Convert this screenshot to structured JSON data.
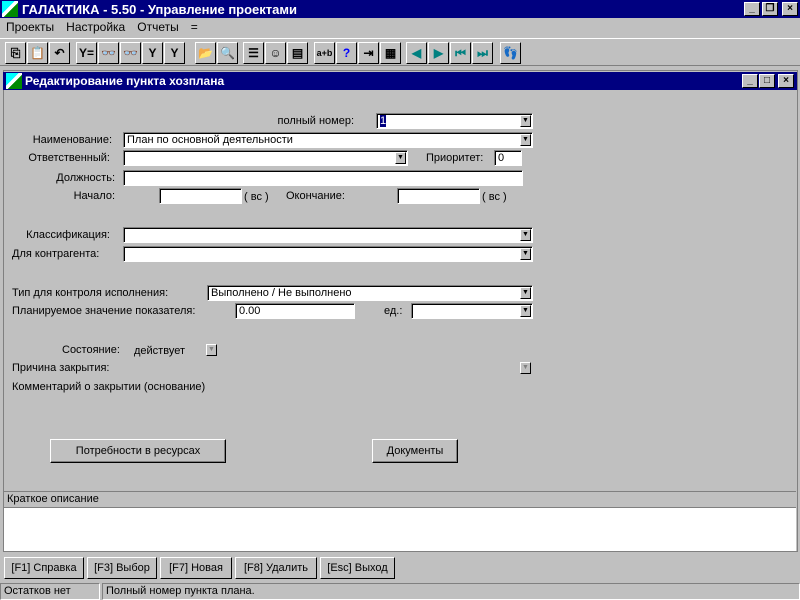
{
  "app": {
    "title": "ГАЛАКТИКА - 5.50 - Управление проектами",
    "controls": [
      "_",
      "❐",
      "×"
    ]
  },
  "menu": [
    "Проекты",
    "Настройка",
    "Отчеты",
    "="
  ],
  "toolbar": [
    {
      "name": "copy",
      "glyph": "⎘"
    },
    {
      "name": "paste",
      "glyph": "📋"
    },
    {
      "name": "undo",
      "glyph": "↶"
    },
    {
      "name": "filter",
      "glyph": "Y="
    },
    {
      "name": "find",
      "glyph": "👓"
    },
    {
      "name": "find-more",
      "glyph": "👓"
    },
    {
      "name": "filter-find",
      "glyph": "Y"
    },
    {
      "name": "filter-find-more",
      "glyph": "Y"
    },
    {
      "name": "open-folder",
      "glyph": "📂"
    },
    {
      "name": "search-folder",
      "glyph": "🔍"
    },
    {
      "name": "list",
      "glyph": "☰"
    },
    {
      "name": "smiley",
      "glyph": "☺"
    },
    {
      "name": "records",
      "glyph": "▤"
    },
    {
      "name": "calc",
      "glyph": "a+b"
    },
    {
      "name": "help",
      "glyph": "?"
    },
    {
      "name": "exit-door",
      "glyph": "⇥"
    },
    {
      "name": "form",
      "glyph": "▦"
    },
    {
      "name": "prev",
      "glyph": "◀"
    },
    {
      "name": "next",
      "glyph": "▶"
    },
    {
      "name": "first",
      "glyph": "⏮"
    },
    {
      "name": "last",
      "glyph": "⏭"
    },
    {
      "name": "footprints",
      "glyph": "👣"
    }
  ],
  "window": {
    "title": "Редактирование пункта хозплана",
    "controls": [
      "_",
      "□",
      "×"
    ]
  },
  "form": {
    "full_number_label": "полный номер:",
    "full_number": "1",
    "name_label": "Наименование:",
    "name": "План по основной деятельности",
    "responsible_label": "Ответственный:",
    "responsible": "",
    "priority_label": "Приоритет:",
    "priority": "0",
    "position_label": "Должность:",
    "position": "",
    "start_label": "Начало:",
    "start": "",
    "start_day": "( вс )",
    "end_label": "Окончание:",
    "end": "",
    "end_day": "( вс )",
    "class_label": "Классификация:",
    "class": "",
    "contractor_label": "Для контрагента:",
    "contractor": "",
    "control_type_label": "Тип для контроля исполнения:",
    "control_type": "Выполнено / Не выполнено",
    "planned_label": "Планируемое значение показателя:",
    "planned": "0.00",
    "unit_label": "ед.:",
    "unit": "",
    "state_label": "Состояние:",
    "state": "действует",
    "close_reason_label": "Причина закрытия:",
    "close_comment_label": "Комментарий о закрытии (основание)",
    "resources_button": "Потребности в ресурсах",
    "documents_button": "Документы"
  },
  "description": {
    "label": "Краткое описание",
    "text": ""
  },
  "fkeys": [
    "[F1] Справка",
    "[F3] Выбор",
    "[F7] Новая",
    "[F8] Удалить",
    "[Esc] Выход"
  ],
  "status": {
    "left": "Остатков нет",
    "main": "Полный номер пункта плана."
  }
}
